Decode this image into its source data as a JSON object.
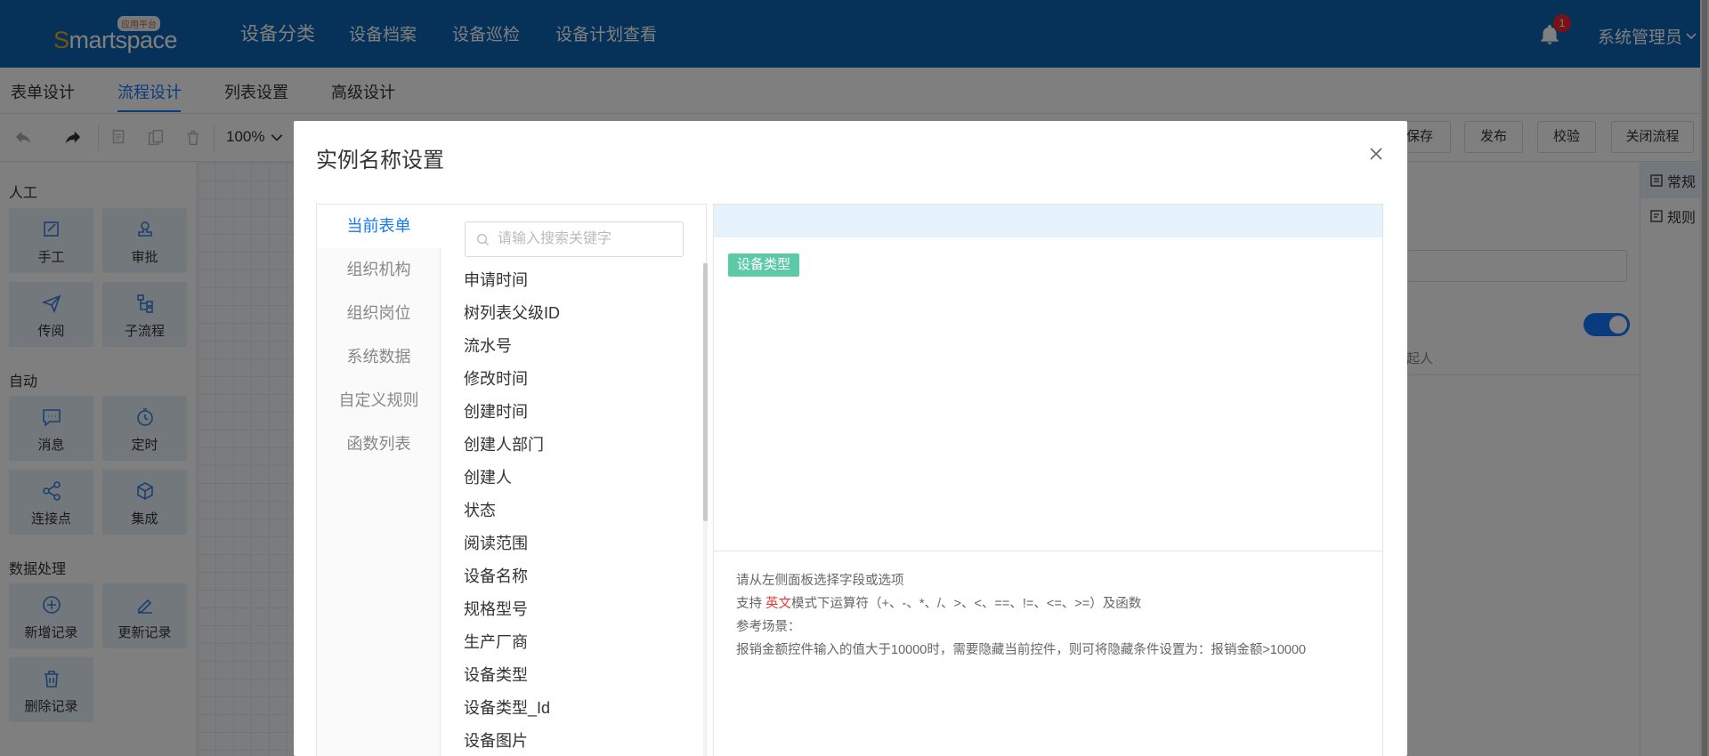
{
  "header": {
    "logo_badge": "应用平台",
    "logo_first": "S",
    "logo_rest": "martspace",
    "nav": [
      "设备分类",
      "设备档案",
      "设备巡检",
      "设备计划查看"
    ],
    "notif_count": "1",
    "user": "系统管理员"
  },
  "design_tabs": [
    "表单设计",
    "流程设计",
    "列表设置",
    "高级设计"
  ],
  "toolbar": {
    "zoom": "100%",
    "buttons": [
      "保存",
      "发布",
      "校验",
      "关闭流程"
    ]
  },
  "palette": {
    "groups": [
      {
        "title": "人工",
        "items": [
          "手工",
          "审批",
          "传阅",
          "子流程"
        ]
      },
      {
        "title": "自动",
        "items": [
          "消息",
          "定时",
          "连接点",
          "集成"
        ]
      },
      {
        "title": "数据处理",
        "items": [
          "新增记录",
          "更新记录",
          "删除记录"
        ]
      }
    ]
  },
  "right_panel": {
    "tabs": [
      "常规",
      "规则"
    ],
    "hint": "起人"
  },
  "modal": {
    "title": "实例名称设置",
    "categories": [
      "当前表单",
      "组织机构",
      "组织岗位",
      "系统数据",
      "自定义规则",
      "函数列表"
    ],
    "search_placeholder": "请输入搜索关键字",
    "fields": [
      "申请时间",
      "树列表父级ID",
      "流水号",
      "修改时间",
      "创建时间",
      "创建人部门",
      "创建人",
      "状态",
      "阅读范围",
      "设备名称",
      "规格型号",
      "生产厂商",
      "设备类型",
      "设备类型_Id",
      "设备图片"
    ],
    "selected_chip": "设备类型",
    "help": {
      "line1": "请从左侧面板选择字段或选项",
      "line2_prefix": "支持 ",
      "line2_red": "英文",
      "line2_suffix": "模式下运算符（+、-、*、/、>、<、==、!=、<=、>=）及函数",
      "line3": "参考场景：",
      "line4": "报销金额控件输入的值大于10000时，需要隐藏当前控件，则可将隐藏条件设置为：报销金额>10000"
    }
  }
}
